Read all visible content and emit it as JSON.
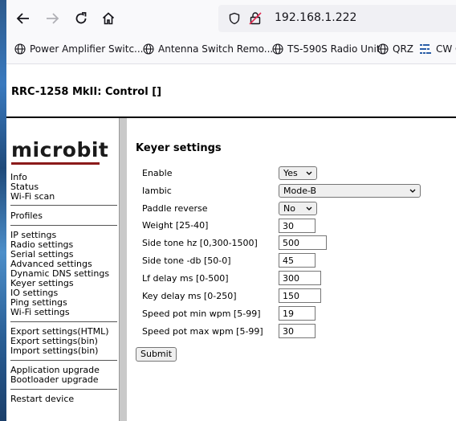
{
  "browser": {
    "url": "192.168.1.222",
    "bookmarks": [
      {
        "label": "Power Amplifier Switc..."
      },
      {
        "label": "Antenna Switch Remo..."
      },
      {
        "label": "TS-590S Radio Unit"
      },
      {
        "label": "QRZ"
      },
      {
        "label": "CW C"
      }
    ]
  },
  "page": {
    "title": "RRC-1258 MkII: Control []"
  },
  "sidebar": {
    "logo": "microbit",
    "group1": [
      "Info",
      "Status",
      "Wi-Fi scan"
    ],
    "group2": [
      "Profiles"
    ],
    "group3": [
      "IP settings",
      "Radio settings",
      "Serial settings",
      "Advanced settings",
      "Dynamic DNS settings",
      "Keyer settings",
      "IO settings",
      "Ping settings",
      "Wi-Fi settings"
    ],
    "group4": [
      "Export settings(HTML)",
      "Export settings(bin)",
      "Import settings(bin)"
    ],
    "group5": [
      "Application upgrade",
      "Bootloader upgrade"
    ],
    "group6": [
      "Restart device"
    ]
  },
  "form": {
    "title": "Keyer settings",
    "fields": [
      {
        "label": "Enable",
        "value": "Yes"
      },
      {
        "label": "Iambic",
        "value": "Mode-B"
      },
      {
        "label": "Paddle reverse",
        "value": "No"
      },
      {
        "label": "Weight [25-40]",
        "value": "30"
      },
      {
        "label": "Side tone hz [0,300-1500]",
        "value": "500"
      },
      {
        "label": "Side tone -db [50-0]",
        "value": "45"
      },
      {
        "label": "Lf delay ms [0-500]",
        "value": "300"
      },
      {
        "label": "Key delay ms [0-250]",
        "value": "150"
      },
      {
        "label": "Speed pot min wpm [5-99]",
        "value": "19"
      },
      {
        "label": "Speed pot max wpm [5-99]",
        "value": "30"
      }
    ],
    "submit_label": "Submit"
  }
}
